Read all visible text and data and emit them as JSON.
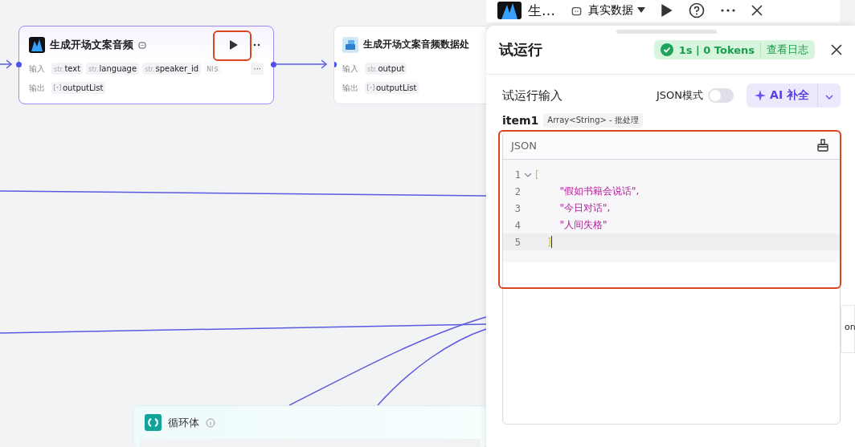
{
  "canvas": {
    "nodes": [
      {
        "title": "生成开场文案音频",
        "selected": true,
        "inputs_label": "输入",
        "outputs_label": "输出",
        "inputs": [
          {
            "type": "str.",
            "name": "text",
            "faded": false
          },
          {
            "type": "str.",
            "name": "language",
            "faded": false
          },
          {
            "type": "str.",
            "name": "speaker_id",
            "faded": false
          },
          {
            "type": "Nl",
            "name": "s",
            "faded": true
          }
        ],
        "more_inputs": "···",
        "outputs": [
          {
            "name": "outputList"
          }
        ]
      },
      {
        "title": "生成开场文案音频数据处",
        "selected": false,
        "inputs_label": "输入",
        "outputs_label": "输出",
        "inputs": [
          {
            "type": "str.",
            "name": "output",
            "faded": false
          }
        ],
        "outputs": [
          {
            "name": "outputList"
          }
        ]
      }
    ],
    "loop_node": {
      "title": "循环体"
    },
    "edge_node": {
      "text": "on"
    }
  },
  "node_header": {
    "title": "生…",
    "data_mode": "真实数据"
  },
  "test_run": {
    "title": "试运行",
    "status": {
      "result": "1s | 0 Tokens",
      "log_link": "查看日志"
    },
    "input_label": "试运行输入",
    "json_mode": {
      "label": "JSON模式",
      "on": false
    },
    "ai_button": "AI 补全",
    "field": {
      "name": "item1",
      "type": "Array<String> - 批处理"
    },
    "editor": {
      "language": "JSON",
      "lines": [
        {
          "number": "1",
          "kind": "bracket",
          "text": "[",
          "foldable": true,
          "current": false
        },
        {
          "number": "2",
          "kind": "string",
          "text": "        \"假如书籍会说话\",",
          "foldable": false,
          "current": false
        },
        {
          "number": "3",
          "kind": "string",
          "text": "        \"今日对话\",",
          "foldable": false,
          "current": false
        },
        {
          "number": "4",
          "kind": "string",
          "text": "        \"人间失格\"",
          "foldable": false,
          "current": false
        },
        {
          "number": "5",
          "kind": "bracket",
          "text": "    ]",
          "foldable": false,
          "current": true
        }
      ]
    }
  }
}
